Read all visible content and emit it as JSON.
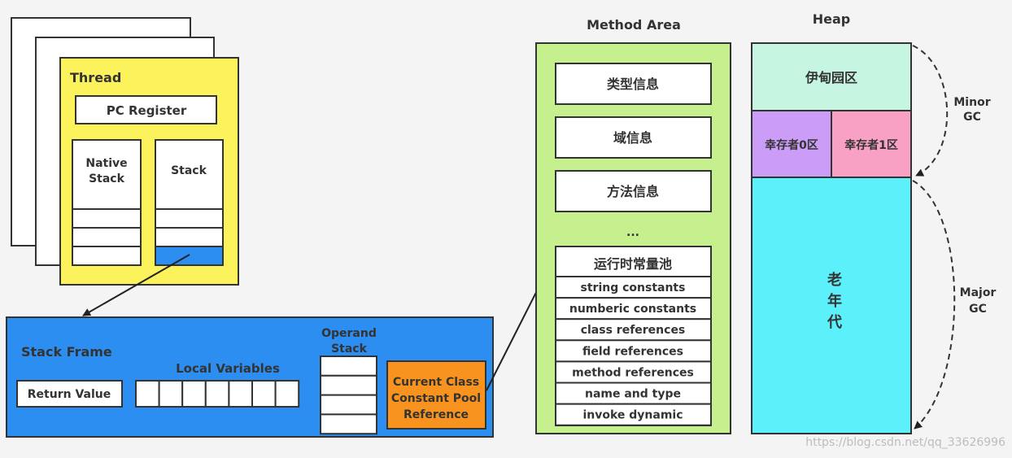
{
  "colors": {
    "background": "#f4f4f4",
    "thread": "#fbf25c",
    "stack_frame": "#2b8ef0",
    "current_frame": "#2b8ef0",
    "constant_pool_ref": "#f7931e",
    "method_area": "#c6ef8e",
    "eden": "#c6f6e1",
    "survivor0": "#cc9df7",
    "survivor1": "#f9a1c4",
    "old_gen": "#5cf1fa"
  },
  "thread": {
    "title": "Thread",
    "pc_register": "PC Register",
    "native_stack": [
      "Native",
      "Stack"
    ],
    "stack": "Stack"
  },
  "stack_frame": {
    "title": "Stack Frame",
    "return_value": "Return Value",
    "local_variables": "Local Variables",
    "operand_stack": [
      "Operand",
      "Stack"
    ],
    "constant_pool_ref": [
      "Current Class",
      "Constant Pool",
      "Reference"
    ]
  },
  "method_area": {
    "title": "Method Area",
    "items": [
      "类型信息",
      "域信息",
      "方法信息"
    ],
    "ellipsis": "...",
    "runtime_pool": {
      "title": "运行时常量池",
      "rows": [
        "string constants",
        "numberic constants",
        "class references",
        "field references",
        "method references",
        "name and type",
        "invoke dynamic"
      ]
    }
  },
  "heap": {
    "title": "Heap",
    "eden": "伊甸园区",
    "survivor0": "幸存者0区",
    "survivor1": "幸存者1区",
    "old_gen": [
      "老",
      "年",
      "代"
    ],
    "minor_gc": [
      "Minor",
      "GC"
    ],
    "major_gc": [
      "Major",
      "GC"
    ]
  },
  "watermark": "https://blog.csdn.net/qq_33626996"
}
